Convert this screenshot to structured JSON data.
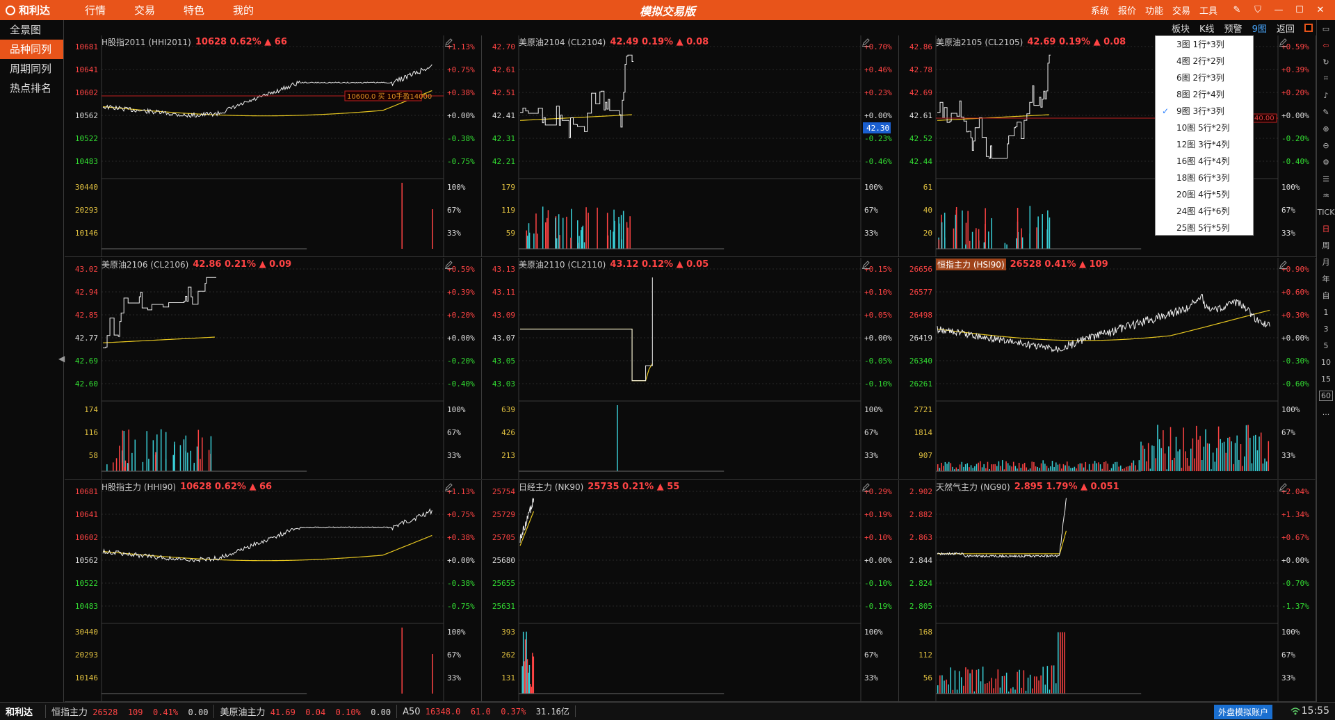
{
  "app": {
    "logo": "和利达",
    "menu": [
      "行情",
      "交易",
      "特色",
      "我的"
    ],
    "title": "模拟交易版",
    "title_links": [
      "系统",
      "报价",
      "功能",
      "交易",
      "工具"
    ]
  },
  "leftnav": [
    "全景图",
    "品种同列",
    "周期同列",
    "热点排名"
  ],
  "right_tabs": [
    "板块",
    "K线",
    "预警",
    "9图",
    "返回"
  ],
  "dropdown": [
    "3图  1行*3列",
    "4图  2行*2列",
    "6图  2行*3列",
    "8图  2行*4列",
    "9图  3行*3列",
    "10图  5行*2列",
    "12图  3行*4列",
    "16图  4行*4列",
    "18图  6行*3列",
    "20图  4行*5列",
    "24图  4行*6列",
    "25图  5行*5列"
  ],
  "dropdown_selected": 4,
  "right_toolbar": [
    "TICK",
    "日",
    "周",
    "月",
    "年",
    "自",
    "1",
    "3",
    "5",
    "10",
    "15",
    "60",
    "..."
  ],
  "cells": [
    {
      "name": "H股指2011 (HHI2011)",
      "quote": "10628 0.62% ▲ 66",
      "boxed": false,
      "price_labels": [
        "10681",
        "10641",
        "10602",
        "10562",
        "10522",
        "10483"
      ],
      "pct_labels": [
        "+1.13%",
        "+0.75%",
        "+0.38%",
        "+0.00%",
        "-0.38%",
        "-0.75%"
      ],
      "vol_labels": [
        "30440",
        "20293",
        "10146"
      ],
      "vol_pct": [
        "100%",
        "67%",
        "33%"
      ],
      "order": "10600.0 买 10手盈14000",
      "pattern": "h",
      "vol_pattern": "late"
    },
    {
      "name": "美原油2104 (CL2104)",
      "quote": "42.49 0.19% ▲ 0.08",
      "boxed": false,
      "price_labels": [
        "42.70",
        "42.61",
        "42.51",
        "42.41",
        "42.31",
        "42.21"
      ],
      "pct_labels": [
        "+0.70%",
        "+0.46%",
        "+0.23%",
        "+0.00%",
        "-0.23%",
        "-0.46%"
      ],
      "vol_labels": [
        "179",
        "119",
        "59"
      ],
      "vol_pct": [
        "100%",
        "67%",
        "33%"
      ],
      "price_tag": "42.30",
      "pattern": "oil1",
      "vol_pattern": "sparse"
    },
    {
      "name": "美原油2105 (CL2105)",
      "quote": "42.69 0.19% ▲ 0.08",
      "boxed": false,
      "price_labels": [
        "42.86",
        "42.78",
        "42.69",
        "42.61",
        "42.52",
        "42.44"
      ],
      "pct_labels": [
        "+0.59%",
        "+0.39%",
        "+0.20%",
        "+0.00%",
        "-0.20%",
        "-0.40%"
      ],
      "vol_labels": [
        "61",
        "40",
        "20"
      ],
      "vol_pct": [
        "100%",
        "67%",
        "33%"
      ],
      "order_right": "40.00",
      "pattern": "oil2",
      "vol_pattern": "sparse"
    },
    {
      "name": "美原油2106 (CL2106)",
      "quote": "42.86 0.21% ▲ 0.09",
      "boxed": false,
      "price_labels": [
        "43.02",
        "42.94",
        "42.85",
        "42.77",
        "42.69",
        "42.60"
      ],
      "pct_labels": [
        "+0.59%",
        "+0.39%",
        "+0.20%",
        "+0.00%",
        "-0.20%",
        "-0.40%"
      ],
      "vol_labels": [
        "174",
        "116",
        "58"
      ],
      "vol_pct": [
        "100%",
        "67%",
        "33%"
      ],
      "pattern": "oil3",
      "vol_pattern": "sparse"
    },
    {
      "name": "美原油2110 (CL2110)",
      "quote": "43.12 0.12% ▲ 0.05",
      "boxed": false,
      "price_labels": [
        "43.13",
        "43.11",
        "43.09",
        "43.07",
        "43.05",
        "43.03"
      ],
      "pct_labels": [
        "+0.15%",
        "+0.10%",
        "+0.05%",
        "+0.00%",
        "-0.05%",
        "-0.10%"
      ],
      "vol_labels": [
        "639",
        "426",
        "213"
      ],
      "vol_pct": [
        "100%",
        "67%",
        "33%"
      ],
      "pattern": "step",
      "vol_pattern": "single"
    },
    {
      "name": "恒指主力 (HSI90)",
      "quote": "26528 0.41% ▲ 109",
      "boxed": true,
      "price_labels": [
        "26656",
        "26577",
        "26498",
        "26419",
        "26340",
        "26261"
      ],
      "pct_labels": [
        "+0.90%",
        "+0.60%",
        "+0.30%",
        "+0.00%",
        "-0.30%",
        "-0.60%"
      ],
      "vol_labels": [
        "2721",
        "1814",
        "907"
      ],
      "vol_pct": [
        "100%",
        "67%",
        "33%"
      ],
      "pattern": "hsi",
      "vol_pattern": "dense"
    },
    {
      "name": "H股指主力 (HHI90)",
      "quote": "10628 0.62% ▲ 66",
      "boxed": false,
      "price_labels": [
        "10681",
        "10641",
        "10602",
        "10562",
        "10522",
        "10483"
      ],
      "pct_labels": [
        "+1.13%",
        "+0.75%",
        "+0.38%",
        "+0.00%",
        "-0.38%",
        "-0.75%"
      ],
      "vol_labels": [
        "30440",
        "20293",
        "10146"
      ],
      "vol_pct": [
        "100%",
        "67%",
        "33%"
      ],
      "pattern": "h",
      "vol_pattern": "late"
    },
    {
      "name": "日经主力 (NK90)",
      "quote": "25735 0.21% ▲ 55",
      "boxed": false,
      "price_labels": [
        "25754",
        "25729",
        "25705",
        "25680",
        "25655",
        "25631"
      ],
      "pct_labels": [
        "+0.29%",
        "+0.19%",
        "+0.10%",
        "+0.00%",
        "-0.10%",
        "-0.19%"
      ],
      "vol_labels": [
        "393",
        "262",
        "131"
      ],
      "vol_pct": [
        "100%",
        "67%",
        "33%"
      ],
      "pattern": "nk",
      "vol_pattern": "early"
    },
    {
      "name": "天然气主力 (NG90)",
      "quote": "2.895 1.79% ▲ 0.051",
      "boxed": false,
      "price_labels": [
        "2.902",
        "2.882",
        "2.863",
        "2.844",
        "2.824",
        "2.805"
      ],
      "pct_labels": [
        "+2.04%",
        "+1.34%",
        "+0.67%",
        "+0.00%",
        "-0.70%",
        "-1.37%"
      ],
      "vol_labels": [
        "168",
        "112",
        "56"
      ],
      "vol_pct": [
        "100%",
        "67%",
        "33%"
      ],
      "pattern": "ng",
      "vol_pattern": "sparse2"
    }
  ],
  "status": {
    "logo": "和利达",
    "groups": [
      {
        "name": "恒指主力",
        "values": [
          "26528",
          "109",
          "0.41%",
          "0.00"
        ]
      },
      {
        "name": "美原油主力",
        "values": [
          "41.69",
          "0.04",
          "0.10%",
          "0.00"
        ]
      },
      {
        "name": "A50",
        "values": [
          "16348.0",
          "61.0",
          "0.37%",
          "31.16亿"
        ]
      }
    ],
    "account": "外盘模拟账户",
    "time": "15:55"
  }
}
